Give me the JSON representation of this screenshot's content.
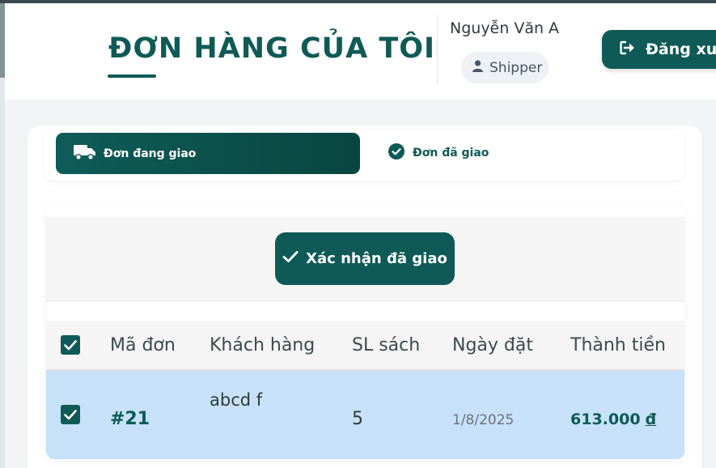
{
  "header": {
    "title": "ĐƠN HÀNG CỦA TÔI",
    "user_name": "Nguyễn Văn A",
    "role": "Shipper",
    "logout_label": "Đăng xuất"
  },
  "tabs": [
    {
      "label": "Đơn đang giao",
      "icon": "truck-icon",
      "active": true
    },
    {
      "label": "Đơn đã giao",
      "icon": "check-circle-icon",
      "active": false
    }
  ],
  "actions": {
    "confirm_label": "Xác nhận đã giao"
  },
  "table": {
    "columns": [
      "Mã đơn",
      "Khách hàng",
      "SL sách",
      "Ngày đặt",
      "Thành tiền"
    ],
    "select_all_checked": true,
    "rows": [
      {
        "selected": true,
        "order_id": "#21",
        "customer": "abcd f",
        "quantity": "5",
        "date": "1/8/2025",
        "total": "613.000",
        "currency": "đ"
      }
    ]
  },
  "colors": {
    "primary": "#0f5a56",
    "row_selected": "#c7e1f8",
    "page_bg": "#f3f4f6"
  }
}
